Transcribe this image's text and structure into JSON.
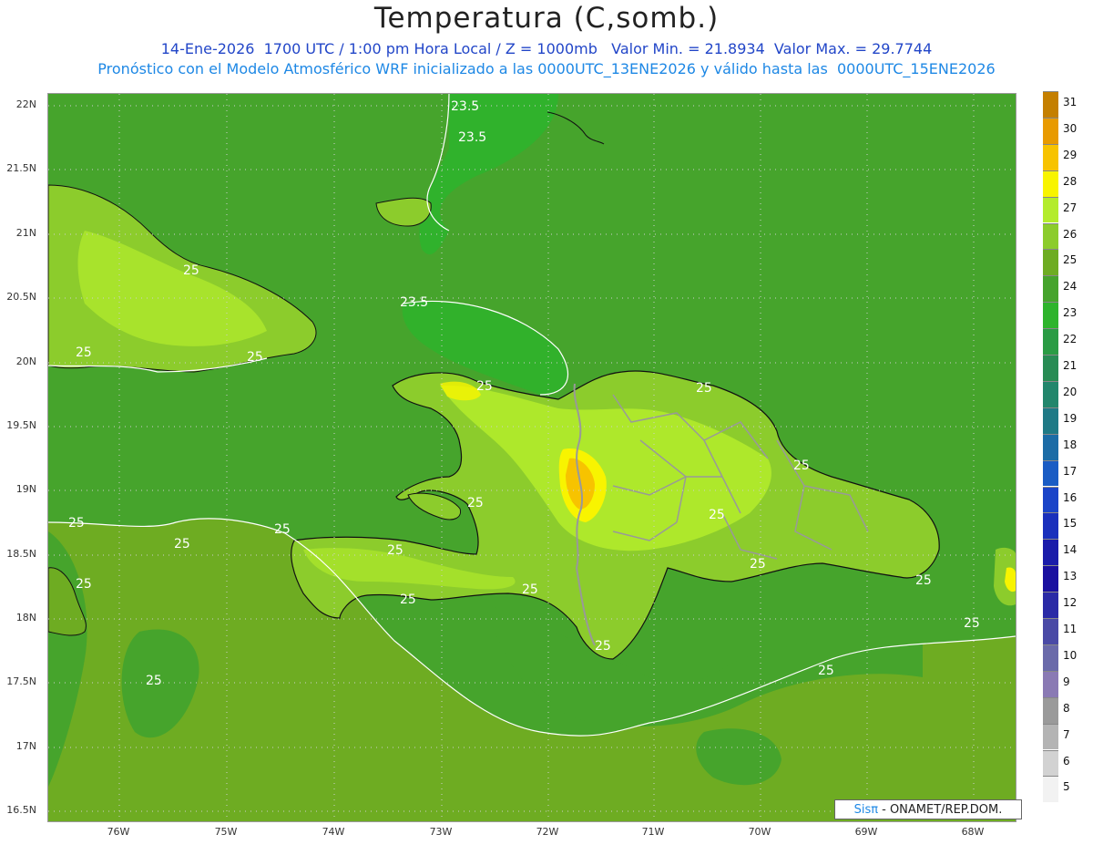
{
  "header": {
    "title": "Temperatura (C,somb.)",
    "line1": "14-Ene-2026  1700 UTC / 1:00 pm Hora Local / Z = 1000mb   Valor Min. = 21.8934  Valor Max. = 29.7744",
    "line2": "Pronóstico con el Modelo Atmosférico WRF inicializado a las 0000UTC_13ENE2026 y válido hasta las  0000UTC_15ENE2026"
  },
  "axes": {
    "lat_labels": [
      "22N",
      "21.5N",
      "21N",
      "20.5N",
      "20N",
      "19.5N",
      "19N",
      "18.5N",
      "18N",
      "17.5N",
      "17N",
      "16.5N"
    ],
    "lon_labels": [
      "76W",
      "75W",
      "74W",
      "73W",
      "72W",
      "71W",
      "70W",
      "69W",
      "68W"
    ]
  },
  "contours": {
    "labels": [
      "23.5",
      "23.5",
      "23.5",
      "25",
      "25",
      "25",
      "25",
      "25",
      "25",
      "25",
      "25",
      "25",
      "25",
      "25",
      "25",
      "25",
      "25",
      "25",
      "25",
      "25",
      "25",
      "25",
      "25",
      "25"
    ]
  },
  "colorbar": {
    "labels": [
      "31",
      "30",
      "29",
      "28",
      "27",
      "26",
      "25",
      "24",
      "23",
      "22",
      "21",
      "20",
      "19",
      "18",
      "17",
      "16",
      "15",
      "14",
      "13",
      "12",
      "11",
      "10",
      "9",
      "8",
      "7",
      "6",
      "5"
    ],
    "colors": [
      "#c47f00",
      "#e89a00",
      "#f7c300",
      "#f8f400",
      "#b4ec2c",
      "#8ccc2c",
      "#6eac22",
      "#46a42c",
      "#2eb42c",
      "#2a9c44",
      "#288c54",
      "#22866c",
      "#1f7a86",
      "#1c6ca6",
      "#1a5cc4",
      "#1a44c8",
      "#1a30bc",
      "#1a1caa",
      "#1a10a0",
      "#2a2aa6",
      "#4a4aa6",
      "#6a6aaa",
      "#8a7ab4",
      "#9a9a9a",
      "#b4b4b4",
      "#d2d2d2",
      "#f2f2f2"
    ]
  },
  "credit": {
    "brand": "Sisπ",
    "text": "- ONAMET/REP.DOM."
  }
}
